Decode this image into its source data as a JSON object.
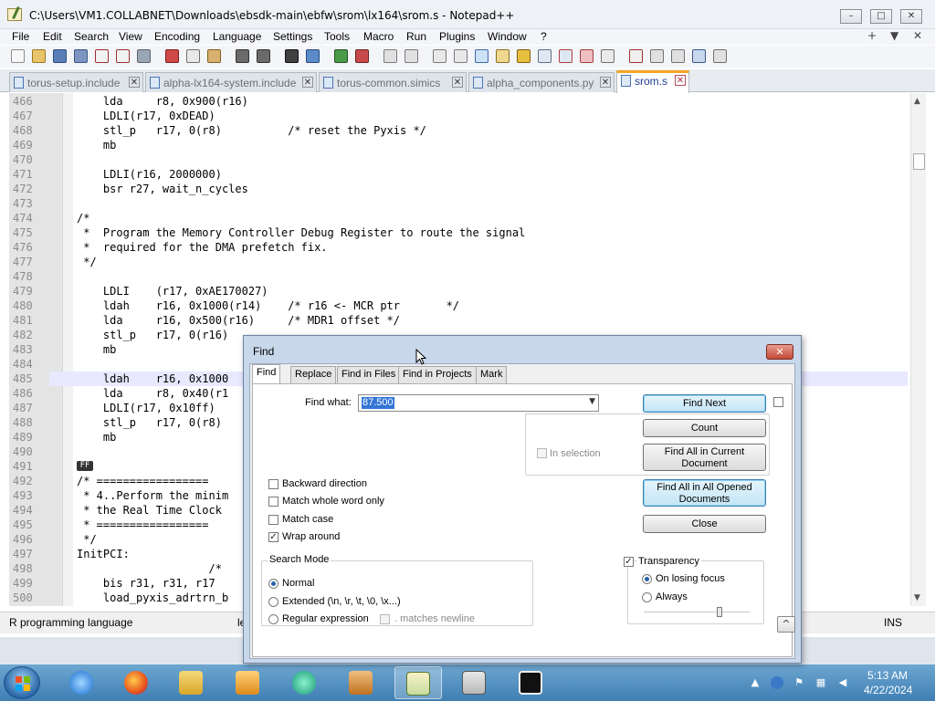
{
  "window": {
    "title": "C:\\Users\\VM1.COLLABNET\\Downloads\\ebsdk-main\\ebfw\\srom\\lx164\\srom.s - Notepad++",
    "minimize": "–",
    "maximize": "□",
    "close": "✕"
  },
  "menu": {
    "items": [
      "File",
      "Edit",
      "Search",
      "View",
      "Encoding",
      "Language",
      "Settings",
      "Tools",
      "Macro",
      "Run",
      "Plugins",
      "Window",
      "?"
    ],
    "right": [
      "+",
      "▼",
      "✕"
    ]
  },
  "tabs": [
    {
      "label": "torus-setup.include",
      "active": false
    },
    {
      "label": "alpha-lx164-system.include",
      "active": false
    },
    {
      "label": "torus-common.simics",
      "active": false
    },
    {
      "label": "alpha_components.py",
      "active": false
    },
    {
      "label": "srom.s",
      "active": true
    }
  ],
  "editor": {
    "highlight_line": "485",
    "lines": [
      {
        "n": "466",
        "t": "    lda     r8, 0x900(r16)"
      },
      {
        "n": "467",
        "t": "    LDLI(r17, 0xDEAD)"
      },
      {
        "n": "468",
        "t": "    stl_p   r17, 0(r8)          /* reset the Pyxis */"
      },
      {
        "n": "469",
        "t": "    mb"
      },
      {
        "n": "470",
        "t": ""
      },
      {
        "n": "471",
        "t": "    LDLI(r16, 2000000)"
      },
      {
        "n": "472",
        "t": "    bsr r27, wait_n_cycles"
      },
      {
        "n": "473",
        "t": ""
      },
      {
        "n": "474",
        "t": "/*"
      },
      {
        "n": "475",
        "t": " *  Program the Memory Controller Debug Register to route the signal"
      },
      {
        "n": "476",
        "t": " *  required for the DMA prefetch fix."
      },
      {
        "n": "477",
        "t": " */"
      },
      {
        "n": "478",
        "t": ""
      },
      {
        "n": "479",
        "t": "    LDLI    (r17, 0xAE170027)"
      },
      {
        "n": "480",
        "t": "    ldah    r16, 0x1000(r14)    /* r16 <- MCR ptr       */"
      },
      {
        "n": "481",
        "t": "    lda     r16, 0x500(r16)     /* MDR1 offset */"
      },
      {
        "n": "482",
        "t": "    stl_p   r17, 0(r16)"
      },
      {
        "n": "483",
        "t": "    mb"
      },
      {
        "n": "484",
        "t": ""
      },
      {
        "n": "485",
        "t": "    ldah    r16, 0x1000"
      },
      {
        "n": "486",
        "t": "    lda     r8, 0x40(r1"
      },
      {
        "n": "487",
        "t": "    LDLI(r17, 0x10ff)"
      },
      {
        "n": "488",
        "t": "    stl_p   r17, 0(r8)"
      },
      {
        "n": "489",
        "t": "    mb"
      },
      {
        "n": "490",
        "t": ""
      },
      {
        "n": "491",
        "t": ""
      },
      {
        "n": "492",
        "t": "/* ================="
      },
      {
        "n": "493",
        "t": " * 4..Perform the minim"
      },
      {
        "n": "494",
        "t": " * the Real Time Clock"
      },
      {
        "n": "495",
        "t": " * ================="
      },
      {
        "n": "496",
        "t": " */"
      },
      {
        "n": "497",
        "t": "InitPCI:"
      },
      {
        "n": "498",
        "t": "                    /*"
      },
      {
        "n": "499",
        "t": "    bis r31, r31, r17"
      },
      {
        "n": "500",
        "t": "    load_pyxis_adrtrn_b"
      }
    ],
    "ff_marker": "FF"
  },
  "status": {
    "language": "R programming language",
    "fragment": "le",
    "ins": "INS"
  },
  "find": {
    "title": "Find",
    "close": "✕",
    "tabs": [
      "Find",
      "Replace",
      "Find in Files",
      "Find in Projects",
      "Mark"
    ],
    "find_what_label": "Find what:",
    "find_what_value": "87.500",
    "buttons": {
      "find_next": "Find Next",
      "count": "Count",
      "find_all_current_1": "Find All in Current",
      "find_all_current_2": "Document",
      "find_all_opened_1": "Find All in All Opened",
      "find_all_opened_2": "Documents",
      "close": "Close"
    },
    "in_selection": "In selection",
    "options": [
      {
        "label": "Backward direction",
        "checked": false
      },
      {
        "label": "Match whole word only",
        "checked": false
      },
      {
        "label": "Match case",
        "checked": false
      },
      {
        "label": "Wrap around",
        "checked": true
      }
    ],
    "search_mode": {
      "title": "Search Mode",
      "normal": "Normal",
      "extended": "Extended (\\n, \\r, \\t, \\0, \\x...)",
      "regex": "Regular expression",
      "matches_newline": ". matches newline"
    },
    "transparency": {
      "title": "Transparency",
      "checked": true,
      "on_losing_focus": "On losing focus",
      "always": "Always"
    },
    "collapse": "^"
  },
  "taskbar": {
    "time": "5:13 AM",
    "date": "4/22/2024",
    "apps": [
      "internet-explorer",
      "firefox",
      "file-explorer",
      "media-player",
      "chat",
      "editor",
      "notepad-plus-plus",
      "hxd",
      "7zip"
    ]
  }
}
